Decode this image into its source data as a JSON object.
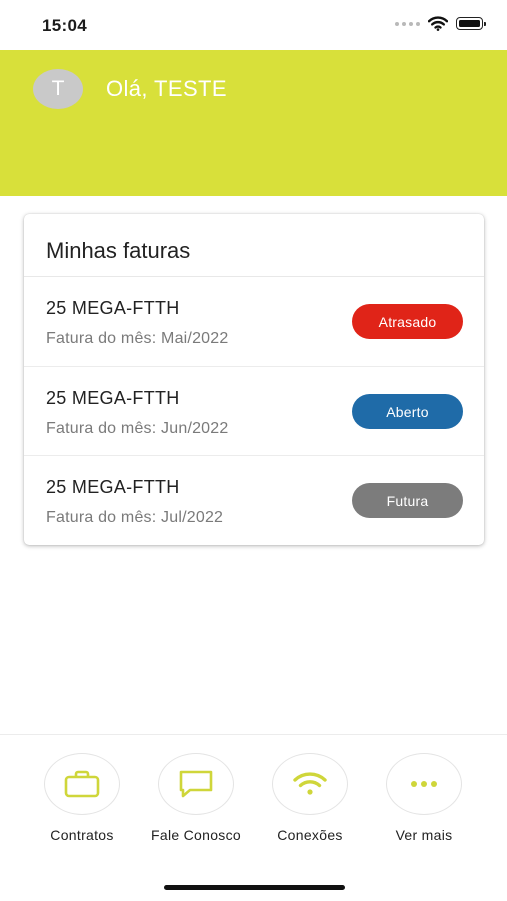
{
  "status_bar": {
    "time": "15:04",
    "icons": [
      "signal-dots-icon",
      "wifi-icon",
      "battery-icon"
    ]
  },
  "header": {
    "avatar_initial": "T",
    "greeting": "Olá, TESTE",
    "background_color": "#d8e03a"
  },
  "invoices_card": {
    "title": "Minhas faturas",
    "items": [
      {
        "plan": "25 MEGA-FTTH",
        "month": "Fatura do mês: Mai/2022",
        "status": "Atrasado",
        "status_color": "#e02418"
      },
      {
        "plan": "25 MEGA-FTTH",
        "month": "Fatura do mês: Jun/2022",
        "status": "Aberto",
        "status_color": "#1f6ba8"
      },
      {
        "plan": "25 MEGA-FTTH",
        "month": "Fatura do mês: Jul/2022",
        "status": "Futura",
        "status_color": "#7c7c7c"
      }
    ]
  },
  "bottom_nav": {
    "accent_color": "#cfd63a",
    "items": [
      {
        "label": "Contratos",
        "icon": "briefcase-icon"
      },
      {
        "label": "Fale Conosco",
        "icon": "chat-bubble-icon"
      },
      {
        "label": "Conexões",
        "icon": "wifi-icon"
      },
      {
        "label": "Ver mais",
        "icon": "more-dots-icon"
      }
    ]
  }
}
